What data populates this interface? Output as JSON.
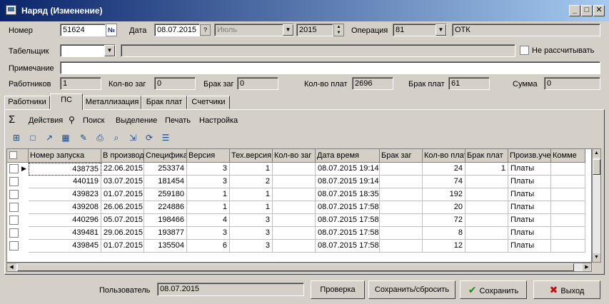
{
  "window": {
    "title": "Наряд (Изменение)"
  },
  "header": {
    "nomer_label": "Номер",
    "nomer_value": "51624",
    "nomer_btn": "№",
    "data_label": "Дата",
    "data_value": "08.07.2015",
    "month_value": "Июль",
    "year_value": "2015",
    "operacia_label": "Операция",
    "operacia_value": "81",
    "operacia_name": "ОТК",
    "tabel_label": "Табельщик",
    "tabel_value": "",
    "tabel_name": "",
    "ne_rasschit_label": "Не рассчитывать",
    "primech_label": "Примечание",
    "primech_value": "",
    "rabotnikov_label": "Работников",
    "rabotnikov_value": "1",
    "kolvo_zag_label": "Кол-во заг",
    "kolvo_zag_value": "0",
    "brak_zag_label": "Брак заг",
    "brak_zag_value": "0",
    "kolvo_plat_label": "Кол-во плат",
    "kolvo_plat_value": "2696",
    "brak_plat_label": "Брак плат",
    "brak_plat_value": "61",
    "summa_label": "Сумма",
    "summa_value": "0"
  },
  "tabs": [
    "Работники",
    "ПС",
    "Металлизация",
    "Брак плат",
    "Счетчики"
  ],
  "menu": {
    "sigma": "Σ",
    "items": [
      "Действия",
      "Поиск",
      "Выделение",
      "Печать",
      "Настройка"
    ]
  },
  "toolbar_icons": [
    "add-row-icon",
    "new-doc-icon",
    "chart-icon",
    "calculator-icon",
    "paint-icon",
    "print-icon",
    "preview-icon",
    "export-icon",
    "refresh-icon",
    "report-icon"
  ],
  "table": {
    "columns": [
      "Номер запуска",
      "В производ",
      "Специфика",
      "Версия",
      "Тех.версия",
      "Кол-во заг",
      "Дата время",
      "Брак заг",
      "Кол-во плат",
      "Брак плат",
      "Произв.уче",
      "Комме"
    ],
    "rows": [
      [
        "438735",
        "22.06.2015",
        "253374",
        "3",
        "1",
        "",
        "08.07.2015 19:14:",
        "",
        "24",
        "1",
        "Платы",
        ""
      ],
      [
        "440119",
        "03.07.2015",
        "181454",
        "3",
        "2",
        "",
        "08.07.2015 19:14:",
        "",
        "74",
        "",
        "Платы",
        ""
      ],
      [
        "439823",
        "01.07.2015",
        "259180",
        "1",
        "1",
        "",
        "08.07.2015 18:35:",
        "",
        "192",
        "",
        "Платы",
        ""
      ],
      [
        "439208",
        "26.06.2015",
        "224886",
        "1",
        "1",
        "",
        "08.07.2015 17:58:",
        "",
        "20",
        "",
        "Платы",
        ""
      ],
      [
        "440296",
        "05.07.2015",
        "198466",
        "4",
        "3",
        "",
        "08.07.2015 17:58:",
        "",
        "72",
        "",
        "Платы",
        ""
      ],
      [
        "439481",
        "29.06.2015",
        "193877",
        "3",
        "3",
        "",
        "08.07.2015 17:58:",
        "",
        "8",
        "",
        "Платы",
        ""
      ],
      [
        "439845",
        "01.07.2015",
        "135504",
        "6",
        "3",
        "",
        "08.07.2015 17:58:",
        "",
        "12",
        "",
        "Платы",
        ""
      ]
    ]
  },
  "footer": {
    "user_label": "Пользователь",
    "user_value": "08.07.2015",
    "check_button": "Проверка",
    "save_reset_button": "Сохранить/сбросить",
    "save_button": "Сохранить",
    "exit_button": "Выход"
  }
}
